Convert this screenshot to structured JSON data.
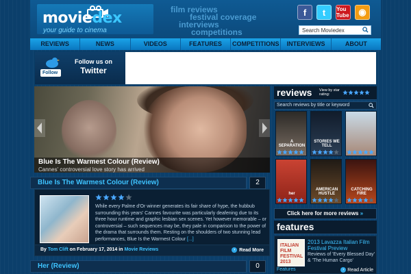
{
  "header": {
    "logo_main": "movie",
    "logo_accent": "dex",
    "logo_tagline": "your guide to cinema",
    "taglines": [
      "film reviews",
      "festival coverage",
      "interviews",
      "competitions"
    ],
    "socials": [
      {
        "name": "facebook",
        "glyph": "f"
      },
      {
        "name": "twitter",
        "glyph": "t"
      },
      {
        "name": "youtube",
        "glyph": "You Tube"
      },
      {
        "name": "rss",
        "glyph": "◉"
      }
    ],
    "search_placeholder": "Search Moviedex"
  },
  "nav": [
    "REVIEWS",
    "NEWS",
    "VIDEOS",
    "FEATURES",
    "COMPETITIONS",
    "INTERVIEWS",
    "ABOUT"
  ],
  "twitter_banner": {
    "follow_button": "Follow",
    "line1": "Follow us on",
    "line2": "Twitter"
  },
  "slider": {
    "title": "Blue Is The Warmest Colour (Review)",
    "subtitle": "Cannes' controversial love story has arrived"
  },
  "posts": [
    {
      "title": "Blue Is The Warmest Colour (Review)",
      "comments": "2",
      "rating": 4,
      "max_rating": 5,
      "excerpt": "While every Palme d'Or winner generates its fair share of hype, the hubbub surrounding this years' Cannes favourite was particularly deafening due to its three hour runtime and graphic lesbian sex scenes. Yet however memorable – or controversial – such sequences may be, they pale in comparison to the power of the drama that surrounds them. Resting on the shoulders of two stunning lead performances, Blue Is the Warmest Colour",
      "excerpt_more": "[...]",
      "by_prefix": "By",
      "author": "Tom Clift",
      "date_text": "on February 17, 2014 in",
      "category": "Movie Reviews",
      "read_more": "Read More"
    },
    {
      "title": "Her (Review)",
      "comments": "0"
    }
  ],
  "reviews_sidebar": {
    "title": "reviews",
    "view_by": "View by star rating:",
    "search_placeholder": "Search reviews by title or keyword",
    "posters": [
      {
        "label": "A SEPARATION",
        "color_top": "#2c2a27",
        "color_bottom": "#7a6d62",
        "stars": 5
      },
      {
        "label": "STORIES WE TELL",
        "color_top": "#111c2b",
        "color_bottom": "#2c3f56",
        "stars": 4
      },
      {
        "label": "",
        "color_top": "#c9dbe8",
        "color_bottom": "#a78877",
        "stars": 5
      },
      {
        "label": "her",
        "color_top": "#c94333",
        "color_bottom": "#8e2318",
        "stars": 5
      },
      {
        "label": "AMERICAN HUSTLE",
        "color_top": "#1f1a15",
        "color_bottom": "#6e4b2a",
        "stars": 4
      },
      {
        "label": "CATCHING FIRE",
        "color_top": "#3b1410",
        "color_bottom": "#b8471c",
        "stars": 4
      }
    ],
    "click_more": "Click here for more reviews",
    "click_arrows": "»"
  },
  "features": {
    "title": "features",
    "image_text": "ITALIAN FILM FESTIVAL 2013",
    "item_title": "2013 Lavazza Italian Film Festival Preview",
    "item_sub": "Reviews of 'Every Blessed Day' & 'The Human Cargo'",
    "footer_left": "Features",
    "footer_right": "Read Article"
  },
  "colors": {
    "accent": "#3ec3ff",
    "star": "#4aa8ff",
    "nav": "#1aa3e8"
  }
}
